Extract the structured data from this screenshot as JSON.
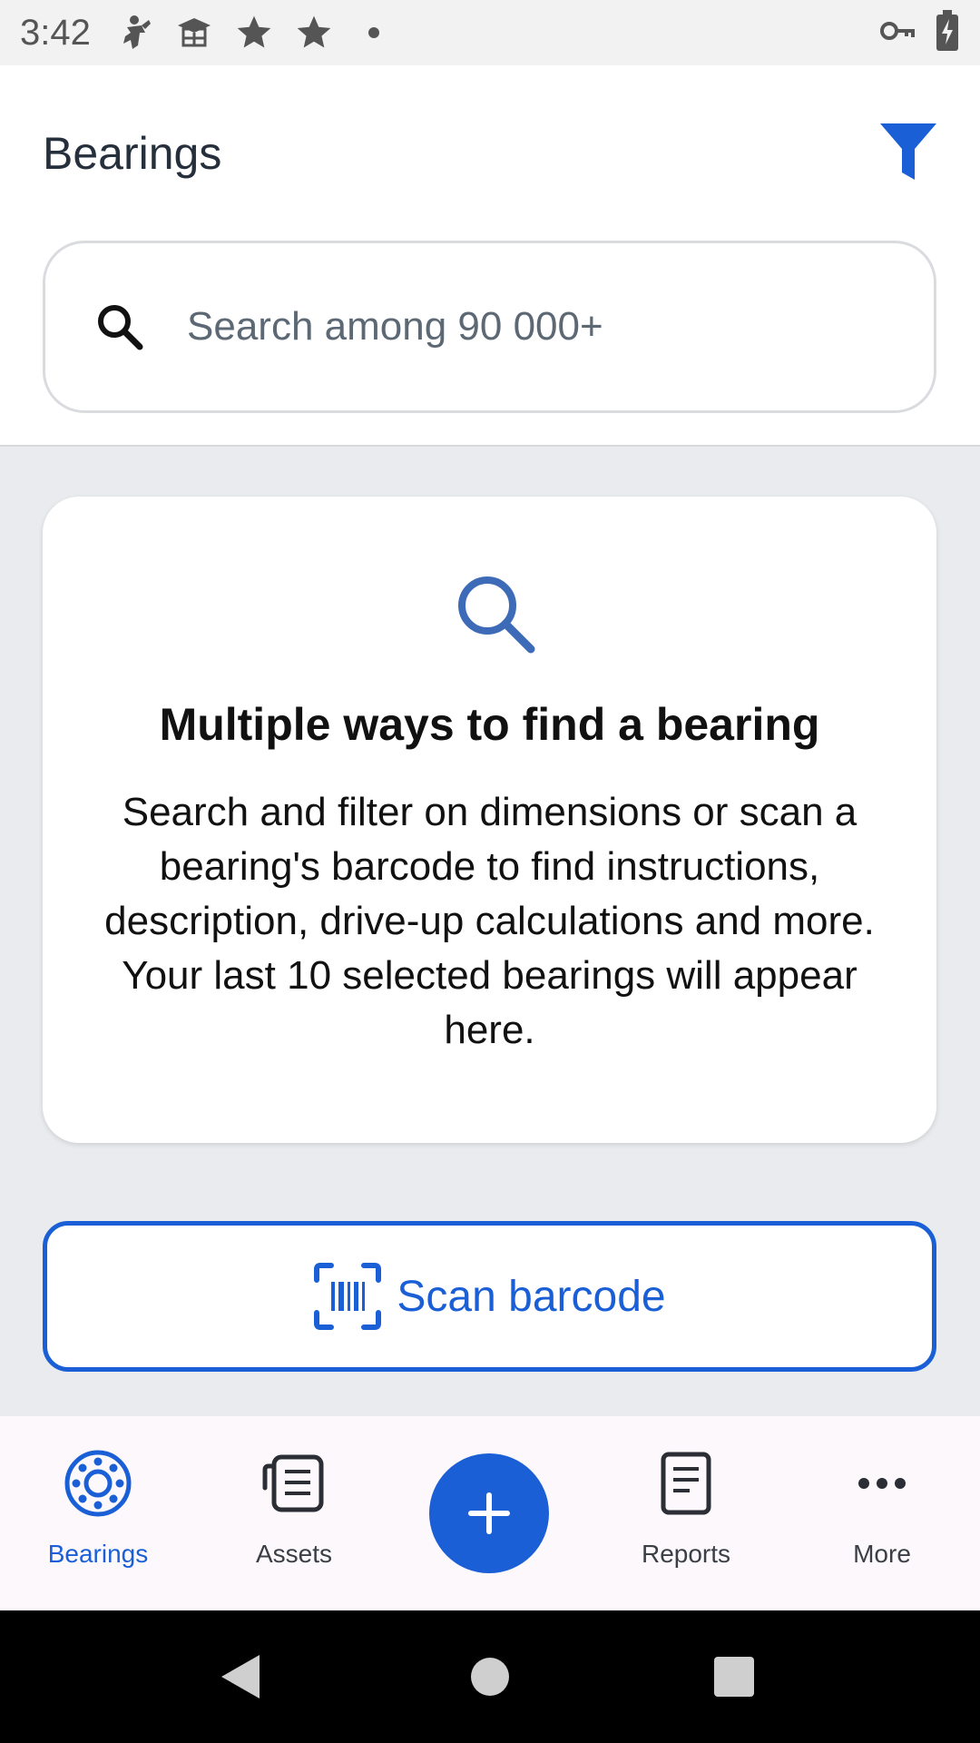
{
  "status_bar": {
    "time": "3:42",
    "left_icons": [
      "fitness-icon",
      "graduation-cap-icon",
      "star-icon",
      "star-icon",
      "dot-icon"
    ],
    "right_icons": [
      "vpn-key-icon",
      "battery-charging-icon"
    ]
  },
  "header": {
    "title": "Bearings",
    "filter_icon": "filter-icon",
    "search": {
      "placeholder": "Search among 90 000+"
    }
  },
  "info_card": {
    "icon": "search-icon",
    "title": "Multiple ways to find a bearing",
    "body": "Search and filter on dimensions or scan a bearing's barcode to find instructions, description, drive-up calculations and more. Your last 10 selected bearings will appear here."
  },
  "scan_button": {
    "label": "Scan barcode",
    "icon": "barcode-scan-icon"
  },
  "bottom_nav": {
    "items": [
      {
        "label": "Bearings",
        "icon": "bearing-icon",
        "active": true
      },
      {
        "label": "Assets",
        "icon": "assets-icon",
        "active": false
      },
      {
        "label": "Reports",
        "icon": "report-icon",
        "active": false
      },
      {
        "label": "More",
        "icon": "more-icon",
        "active": false
      }
    ],
    "fab_icon": "plus-icon"
  },
  "colors": {
    "accent": "#1a5fd6",
    "text_dark": "#26303d",
    "background": "#e9ebee"
  }
}
